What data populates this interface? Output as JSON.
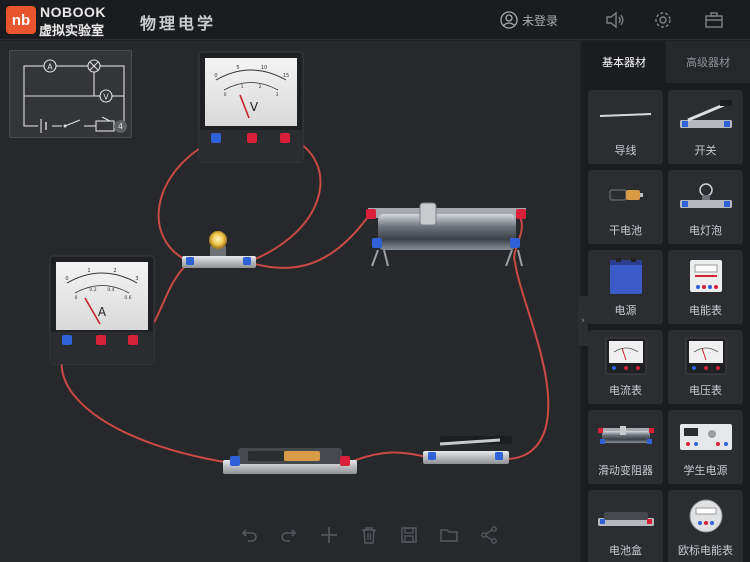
{
  "header": {
    "logo_text": "nb",
    "brand_top": "NOBOOK",
    "brand_bottom": "虚拟实验室",
    "title": "物理电学",
    "login_label": "未登录",
    "icons": [
      "user-icon",
      "speaker-icon",
      "gear-icon",
      "toolbox-icon"
    ]
  },
  "canvas": {
    "thumbnail_badge": "4",
    "voltmeter_symbol": "V",
    "ammeter_symbol": "A",
    "voltmeter_scale": [
      "0",
      "5",
      "10",
      "15"
    ],
    "voltmeter_scale_inner": [
      "0",
      "1",
      "2",
      "3"
    ],
    "ammeter_scale": [
      "0",
      "1",
      "2",
      "3"
    ],
    "ammeter_scale_inner": [
      "0",
      "0.2",
      "0.4",
      "0.6"
    ],
    "wire_color": "#c94a46"
  },
  "toolbar": {
    "undo": "undo-icon",
    "redo": "redo-icon",
    "add": "plus-icon",
    "delete": "trash-icon",
    "save": "save-icon",
    "open": "folder-icon",
    "share": "share-icon"
  },
  "panel": {
    "tabs": [
      {
        "label": "基本器材",
        "active": true
      },
      {
        "label": "高级器材",
        "active": false
      }
    ],
    "items": [
      {
        "label": "导线"
      },
      {
        "label": "开关"
      },
      {
        "label": "干电池"
      },
      {
        "label": "电灯泡"
      },
      {
        "label": "电源"
      },
      {
        "label": "电能表"
      },
      {
        "label": "电流表"
      },
      {
        "label": "电压表"
      },
      {
        "label": "滑动变阻器"
      },
      {
        "label": "学生电源"
      },
      {
        "label": "电池盒"
      },
      {
        "label": "欧标电能表"
      }
    ]
  },
  "colors": {
    "accent": "#e9562d",
    "terminal_red": "#d8203a",
    "terminal_blue": "#2e62d6"
  }
}
